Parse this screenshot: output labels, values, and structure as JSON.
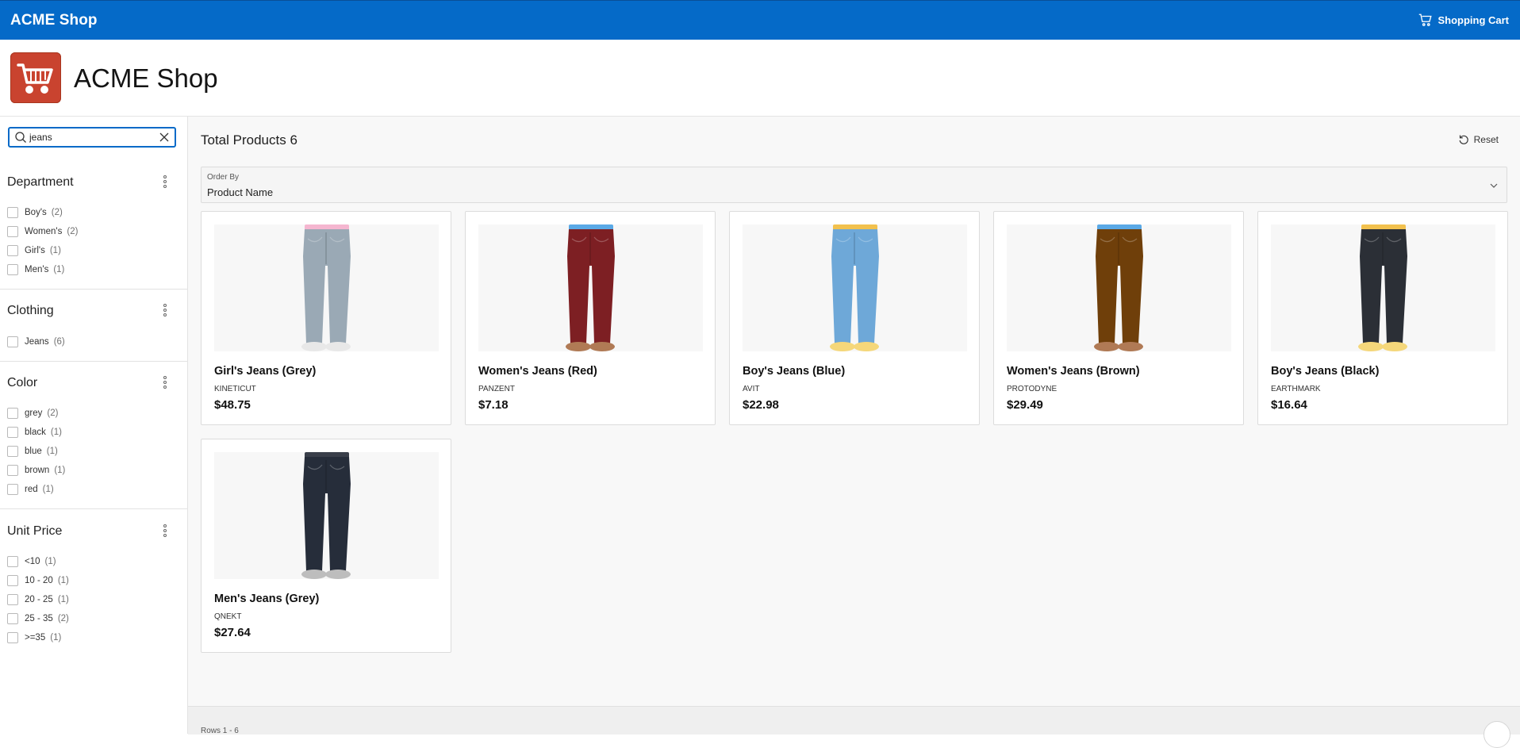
{
  "topbar": {
    "brand": "ACME Shop",
    "cart_label": "Shopping Cart",
    "bg_color": "#056ac8"
  },
  "header": {
    "title": "ACME Shop",
    "logo_icon": "shopping-cart-icon",
    "logo_color": "#c9432f"
  },
  "sidebar": {
    "search": {
      "value": "jeans",
      "icon": "search-icon",
      "clear_icon": "close-icon"
    },
    "facets": [
      {
        "title": "Department",
        "options": [
          {
            "label": "Boy's",
            "count": "(2)"
          },
          {
            "label": "Women's",
            "count": "(2)"
          },
          {
            "label": "Girl's",
            "count": "(1)"
          },
          {
            "label": "Men's",
            "count": "(1)"
          }
        ]
      },
      {
        "title": "Clothing",
        "options": [
          {
            "label": "Jeans",
            "count": "(6)"
          }
        ]
      },
      {
        "title": "Color",
        "options": [
          {
            "label": "grey",
            "count": "(2)"
          },
          {
            "label": "black",
            "count": "(1)"
          },
          {
            "label": "blue",
            "count": "(1)"
          },
          {
            "label": "brown",
            "count": "(1)"
          },
          {
            "label": "red",
            "count": "(1)"
          }
        ]
      },
      {
        "title": "Unit Price",
        "options": [
          {
            "label": "<10",
            "count": "(1)"
          },
          {
            "label": "10 - 20",
            "count": "(1)"
          },
          {
            "label": "20 - 25",
            "count": "(1)"
          },
          {
            "label": "25 - 35",
            "count": "(2)"
          },
          {
            "label": ">=35",
            "count": "(1)"
          }
        ]
      }
    ]
  },
  "main": {
    "total_label": "Total Products 6",
    "reset_label": "Reset",
    "order_by": {
      "label": "Order By",
      "value": "Product Name"
    },
    "products": [
      {
        "name": "Girl's Jeans (Grey)",
        "brand": "KINETICUT",
        "price": "$48.75",
        "jeans_color": "#9aa9b5",
        "waist_color": "#f5b6d0",
        "shoe_color": "#e8e8e8"
      },
      {
        "name": "Women's Jeans (Red)",
        "brand": "PANZENT",
        "price": "$7.18",
        "jeans_color": "#7d1f23",
        "waist_color": "#5aa9e6",
        "shoe_color": "#b07a55"
      },
      {
        "name": "Boy's Jeans (Blue)",
        "brand": "AVIT",
        "price": "$22.98",
        "jeans_color": "#6ea8d8",
        "waist_color": "#f2c14e",
        "shoe_color": "#f5d77a"
      },
      {
        "name": "Women's Jeans (Brown)",
        "brand": "PROTODYNE",
        "price": "$29.49",
        "jeans_color": "#6f3f0a",
        "waist_color": "#5aa9e6",
        "shoe_color": "#b07a55"
      },
      {
        "name": "Boy's Jeans (Black)",
        "brand": "EARTHMARK",
        "price": "$16.64",
        "jeans_color": "#2b2f36",
        "waist_color": "#f2c14e",
        "shoe_color": "#f5d77a"
      },
      {
        "name": "Men's Jeans (Grey)",
        "brand": "QNEKT",
        "price": "$27.64",
        "jeans_color": "#262d3a",
        "waist_color": "#3a3f4a",
        "shoe_color": "#bdbdbd"
      }
    ],
    "footer_text": "Rows 1 - 6"
  }
}
